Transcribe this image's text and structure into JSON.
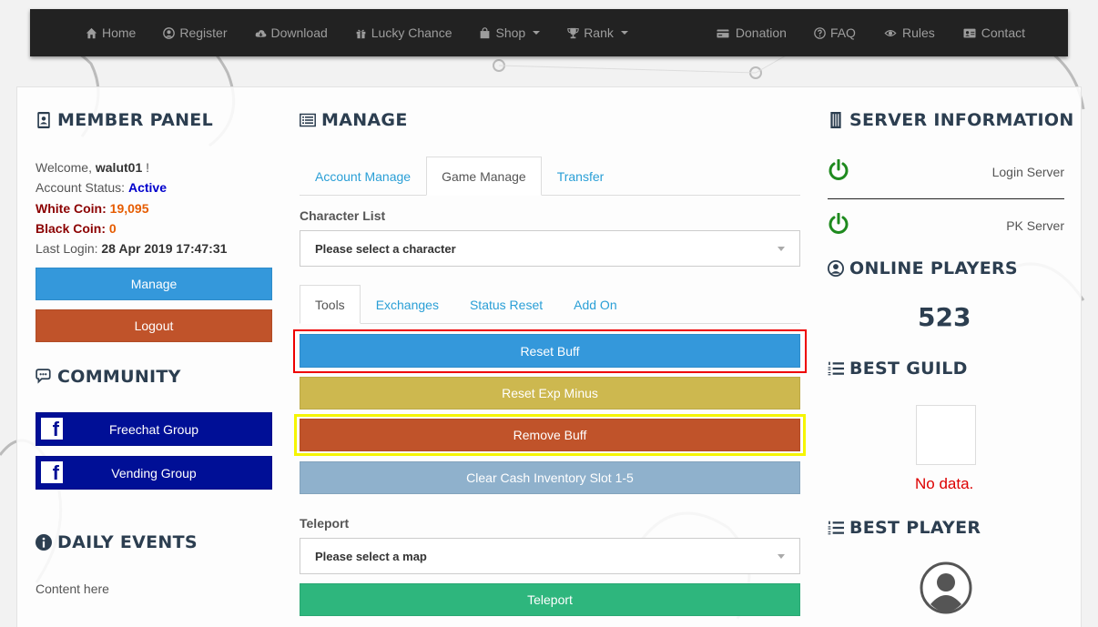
{
  "nav": {
    "left": [
      {
        "label": "Home",
        "icon": "home-icon"
      },
      {
        "label": "Register",
        "icon": "user-circle-icon"
      },
      {
        "label": "Download",
        "icon": "cloud-download-icon"
      },
      {
        "label": "Lucky Chance",
        "icon": "gift-icon"
      },
      {
        "label": "Shop",
        "icon": "shopping-bag-icon",
        "dropdown": true
      },
      {
        "label": "Rank",
        "icon": "trophy-icon",
        "dropdown": true
      }
    ],
    "right": [
      {
        "label": "Donation",
        "icon": "credit-card-icon"
      },
      {
        "label": "FAQ",
        "icon": "question-circle-icon"
      },
      {
        "label": "Rules",
        "icon": "eye-icon"
      },
      {
        "label": "Contact",
        "icon": "address-card-icon"
      }
    ]
  },
  "member": {
    "title": "MEMBER PANEL",
    "welcome_label": "Welcome,",
    "username": "walut01",
    "welcome_suffix": "!",
    "status_label": "Account Status:",
    "status_value": "Active",
    "white_coin_label": "White Coin",
    "white_coin_value": "19,095",
    "black_coin_label": "Black Coin",
    "black_coin_value": "0",
    "last_login_label": "Last Login:",
    "last_login_value": "28 Apr 2019 17:47:31",
    "manage_button": "Manage",
    "logout_button": "Logout"
  },
  "community": {
    "title": "COMMUNITY",
    "groups": [
      "Freechat Group",
      "Vending Group"
    ]
  },
  "daily_events": {
    "title": "DAILY EVENTS",
    "content": "Content here"
  },
  "manage": {
    "title": "MANAGE",
    "tabs": [
      "Account Manage",
      "Game Manage",
      "Transfer"
    ],
    "active_tab": "Game Manage",
    "character_list_label": "Character List",
    "character_placeholder": "Please select a character",
    "sub_tabs": [
      "Tools",
      "Exchanges",
      "Status Reset",
      "Add On"
    ],
    "active_sub_tab": "Tools",
    "tool_buttons": [
      "Reset Buff",
      "Reset Exp Minus",
      "Remove Buff",
      "Clear Cash Inventory Slot 1-5"
    ],
    "teleport_label": "Teleport",
    "map_placeholder": "Please select a map",
    "teleport_button": "Teleport"
  },
  "server": {
    "title": "SERVER INFORMATION",
    "servers": [
      {
        "name": "Login Server",
        "status_color": "#1e8a1e"
      },
      {
        "name": "PK Server",
        "status_color": "#1e8a1e"
      }
    ]
  },
  "online": {
    "title": "ONLINE PLAYERS",
    "count": "523"
  },
  "best_guild": {
    "title": "BEST GUILD",
    "empty_text": "No data."
  },
  "best_player": {
    "title": "BEST PLAYER"
  },
  "colors": {
    "navbar": "#222222",
    "primary": "#3498db",
    "danger": "#c0532a",
    "facebook": "#000f96",
    "warning": "#cdb84f",
    "muted": "#8fb1cc",
    "success": "#2eb67d",
    "highlight_red": "#ee0000",
    "highlight_yellow": "#f5f500"
  }
}
